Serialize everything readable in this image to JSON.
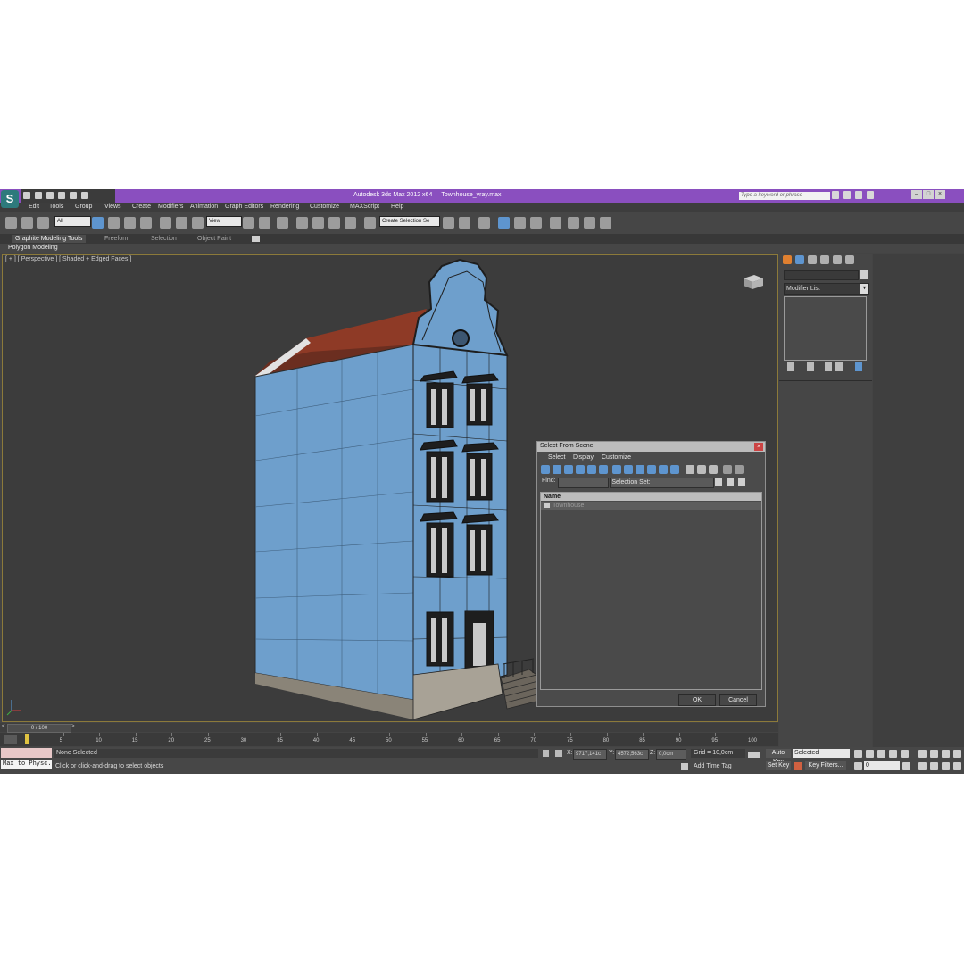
{
  "app": {
    "title": "Autodesk 3ds Max  2012 x64",
    "filename": "Townhouse_vray.max",
    "search_placeholder": "Type a keyword or phrase",
    "logo": "S"
  },
  "window_buttons": [
    "–",
    "□",
    "×"
  ],
  "menu": [
    "Edit",
    "Tools",
    "Group",
    "Views",
    "Create",
    "Modifiers",
    "Animation",
    "Graph Editors",
    "Rendering",
    "Customize",
    "MAXScript",
    "Help"
  ],
  "toolbar": {
    "selection_filter": "All",
    "ref_coord": "View",
    "named_selection": "Create Selection Se"
  },
  "ribbon": {
    "tabs": [
      "Graphite Modeling Tools",
      "Freeform",
      "Selection",
      "Object Paint"
    ],
    "active_panel": "Polygon Modeling"
  },
  "viewport": {
    "label": "[ + ] [ Perspective ] [ Shaded + Edged Faces ]",
    "object_color": "#6e9fcc"
  },
  "dialog": {
    "title": "Select From Scene",
    "close": "×",
    "menu": [
      "Select",
      "Display",
      "Customize"
    ],
    "find_label": "Find:",
    "selection_set_label": "Selection Set:",
    "column_name": "Name",
    "items": [
      "Townhouse"
    ],
    "ok": "OK",
    "cancel": "Cancel"
  },
  "command_panel": {
    "modifier_list": "Modifier List",
    "dropdown_arrow": "▾"
  },
  "timeline": {
    "current": "0 / 100",
    "ticks": [
      "5",
      "10",
      "15",
      "20",
      "25",
      "30",
      "35",
      "40",
      "45",
      "50",
      "55",
      "60",
      "65",
      "70",
      "75",
      "80",
      "85",
      "90",
      "95",
      "100"
    ]
  },
  "status": {
    "maxscript": "Max to Physc.",
    "selection": "None Selected",
    "prompt": "Click or click-and-drag to select objects",
    "x_label": "X:",
    "x_value": "9717,141c",
    "y_label": "Y:",
    "y_value": "4572,563c",
    "z_label": "Z:",
    "z_value": "0,0cm",
    "grid": "Grid = 10,0cm",
    "add_time_tag": "Add Time Tag",
    "auto_key": "Auto Key",
    "set_key": "Set Key",
    "key_mode": "Selected",
    "key_filters": "Key Filters...",
    "frame": "0"
  }
}
